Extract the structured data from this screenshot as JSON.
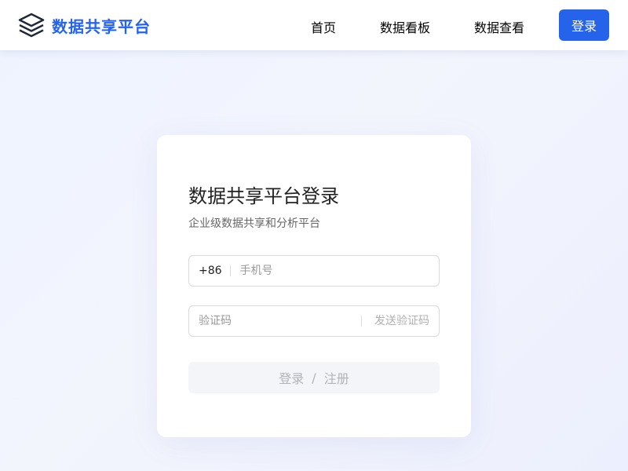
{
  "header": {
    "logo_text": "数据共享平台",
    "logo_icon": "layers-icon",
    "nav": [
      {
        "label": "首页"
      },
      {
        "label": "数据看板"
      },
      {
        "label": "数据查看"
      }
    ],
    "login_label": "登录"
  },
  "login_card": {
    "title": "数据共享平台登录",
    "subtitle": "企业级数据共享和分析平台",
    "phone": {
      "prefix": "+86",
      "placeholder": "手机号",
      "value": ""
    },
    "code": {
      "placeholder": "验证码",
      "value": "",
      "send_label": "发送验证码"
    },
    "submit": {
      "login_label": "登录",
      "separator": "/",
      "register_label": "注册"
    }
  },
  "colors": {
    "brand": "#2563eb",
    "disabled_button_bg": "#f4f5f8",
    "disabled_text": "#b0b3b9"
  }
}
